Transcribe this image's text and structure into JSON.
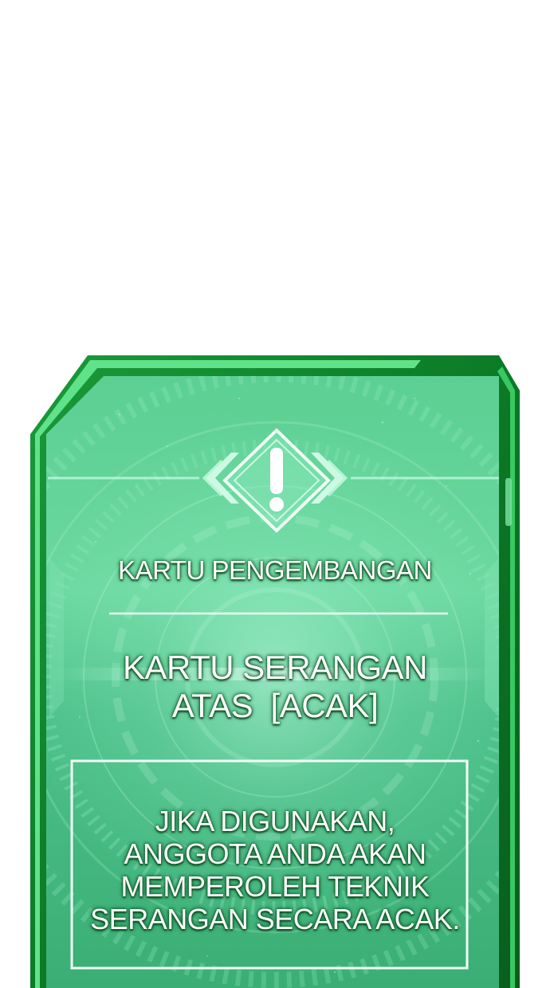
{
  "card": {
    "type_label": "KARTU PENGEMBANGAN",
    "name_lines": [
      "KARTU SERANGAN",
      "ATAS  [ACAK]"
    ],
    "description_lines": [
      "JIKA DIGUNAKAN,",
      "ANGGOTA ANDA AKAN",
      "MEMPEROLEH TEKNIK",
      "SERANGAN SECARA ACAK."
    ],
    "icon": "warning-exclamation-icon",
    "colors": {
      "frame_dark": "#0b6b1f",
      "frame_bright": "#3fd26a",
      "panel_base": "#4cc488",
      "panel_light": "#8fe8b8",
      "text": "#ffffff"
    }
  }
}
